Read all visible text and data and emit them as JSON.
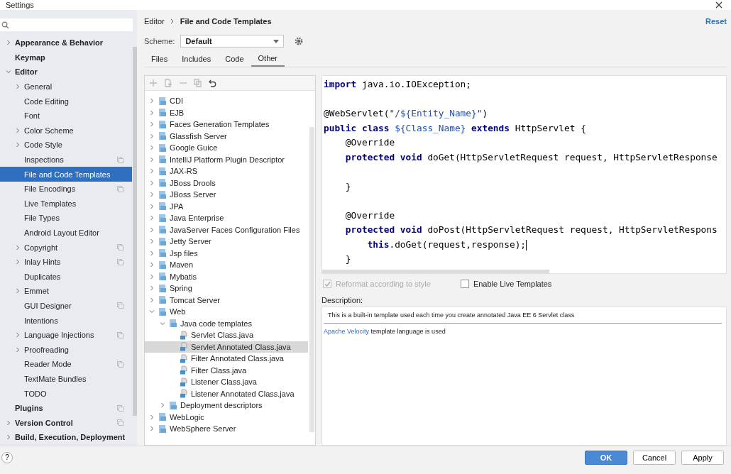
{
  "window": {
    "title": "Settings"
  },
  "sidebar": {
    "items": [
      {
        "label": "Appearance & Behavior",
        "kind": "group",
        "expanded": false,
        "selected": false,
        "scoped": false
      },
      {
        "label": "Keymap",
        "kind": "leaf",
        "selected": false,
        "scoped": false
      },
      {
        "label": "Editor",
        "kind": "group",
        "expanded": true,
        "selected": false,
        "scoped": false,
        "children": [
          {
            "label": "General",
            "kind": "group",
            "expanded": false,
            "selected": false,
            "scoped": false
          },
          {
            "label": "Code Editing",
            "kind": "leaf",
            "selected": false,
            "scoped": false
          },
          {
            "label": "Font",
            "kind": "leaf",
            "selected": false,
            "scoped": false
          },
          {
            "label": "Color Scheme",
            "kind": "group",
            "expanded": false,
            "selected": false,
            "scoped": false
          },
          {
            "label": "Code Style",
            "kind": "group",
            "expanded": false,
            "selected": false,
            "scoped": false
          },
          {
            "label": "Inspections",
            "kind": "leaf",
            "selected": false,
            "scoped": true
          },
          {
            "label": "File and Code Templates",
            "kind": "leaf",
            "selected": true,
            "scoped": false
          },
          {
            "label": "File Encodings",
            "kind": "leaf",
            "selected": false,
            "scoped": true
          },
          {
            "label": "Live Templates",
            "kind": "leaf",
            "selected": false,
            "scoped": false
          },
          {
            "label": "File Types",
            "kind": "leaf",
            "selected": false,
            "scoped": false
          },
          {
            "label": "Android Layout Editor",
            "kind": "leaf",
            "selected": false,
            "scoped": false
          },
          {
            "label": "Copyright",
            "kind": "group",
            "expanded": false,
            "selected": false,
            "scoped": true
          },
          {
            "label": "Inlay Hints",
            "kind": "group",
            "expanded": false,
            "selected": false,
            "scoped": true
          },
          {
            "label": "Duplicates",
            "kind": "leaf",
            "selected": false,
            "scoped": false
          },
          {
            "label": "Emmet",
            "kind": "group",
            "expanded": false,
            "selected": false,
            "scoped": false
          },
          {
            "label": "GUI Designer",
            "kind": "leaf",
            "selected": false,
            "scoped": true
          },
          {
            "label": "Intentions",
            "kind": "leaf",
            "selected": false,
            "scoped": false
          },
          {
            "label": "Language Injections",
            "kind": "group",
            "expanded": false,
            "selected": false,
            "scoped": true
          },
          {
            "label": "Proofreading",
            "kind": "group",
            "expanded": false,
            "selected": false,
            "scoped": false
          },
          {
            "label": "Reader Mode",
            "kind": "leaf",
            "selected": false,
            "scoped": true
          },
          {
            "label": "TextMate Bundles",
            "kind": "leaf",
            "selected": false,
            "scoped": false
          },
          {
            "label": "TODO",
            "kind": "leaf",
            "selected": false,
            "scoped": false
          }
        ]
      },
      {
        "label": "Plugins",
        "kind": "leaf",
        "selected": false,
        "scoped": true
      },
      {
        "label": "Version Control",
        "kind": "group",
        "expanded": false,
        "selected": false,
        "scoped": true
      },
      {
        "label": "Build, Execution, Deployment",
        "kind": "group",
        "expanded": false,
        "selected": false,
        "scoped": false
      }
    ]
  },
  "breadcrumb": [
    "Editor",
    "File and Code Templates"
  ],
  "reset": "Reset",
  "scheme": {
    "label": "Scheme:",
    "value": "Default"
  },
  "tabs": [
    {
      "label": "Files",
      "selected": false
    },
    {
      "label": "Includes",
      "selected": false
    },
    {
      "label": "Code",
      "selected": false
    },
    {
      "label": "Other",
      "selected": true
    }
  ],
  "toolbar": [
    {
      "kind": "add",
      "disabled": true
    },
    {
      "kind": "child",
      "disabled": true
    },
    {
      "kind": "remove",
      "disabled": true
    },
    {
      "kind": "copy",
      "disabled": true
    },
    {
      "kind": "reset",
      "disabled": false
    }
  ],
  "templates": [
    {
      "label": "CDI",
      "kind": "group",
      "expanded": false,
      "selected": false
    },
    {
      "label": "EJB",
      "kind": "group",
      "expanded": false,
      "selected": false
    },
    {
      "label": "Faces Generation Templates",
      "kind": "group",
      "expanded": false,
      "selected": false
    },
    {
      "label": "Glassfish Server",
      "kind": "group",
      "expanded": false,
      "selected": false
    },
    {
      "label": "Google Guice",
      "kind": "group",
      "expanded": false,
      "selected": false
    },
    {
      "label": "IntelliJ Platform Plugin Descriptor",
      "kind": "group",
      "expanded": false,
      "selected": false
    },
    {
      "label": "JAX-RS",
      "kind": "group",
      "expanded": false,
      "selected": false
    },
    {
      "label": "JBoss Drools",
      "kind": "group",
      "expanded": false,
      "selected": false
    },
    {
      "label": "JBoss Server",
      "kind": "group",
      "expanded": false,
      "selected": false
    },
    {
      "label": "JPA",
      "kind": "group",
      "expanded": false,
      "selected": false
    },
    {
      "label": "Java Enterprise",
      "kind": "group",
      "expanded": false,
      "selected": false
    },
    {
      "label": "JavaServer Faces Configuration Files",
      "kind": "group",
      "expanded": false,
      "selected": false
    },
    {
      "label": "Jetty Server",
      "kind": "group",
      "expanded": false,
      "selected": false
    },
    {
      "label": "Jsp files",
      "kind": "group",
      "expanded": false,
      "selected": false
    },
    {
      "label": "Maven",
      "kind": "group",
      "expanded": false,
      "selected": false
    },
    {
      "label": "Mybatis",
      "kind": "group",
      "expanded": false,
      "selected": false
    },
    {
      "label": "Spring",
      "kind": "group",
      "expanded": false,
      "selected": false
    },
    {
      "label": "Tomcat Server",
      "kind": "group",
      "expanded": false,
      "selected": false
    },
    {
      "label": "Web",
      "kind": "group",
      "expanded": true,
      "selected": false,
      "children": [
        {
          "label": "Java code templates",
          "kind": "group",
          "expanded": true,
          "selected": false,
          "children": [
            {
              "label": "Servlet Class.java",
              "kind": "leaf",
              "selected": false
            },
            {
              "label": "Servlet Annotated Class.java",
              "kind": "leaf",
              "selected": true
            },
            {
              "label": "Filter Annotated Class.java",
              "kind": "leaf",
              "selected": false
            },
            {
              "label": "Filter Class.java",
              "kind": "leaf",
              "selected": false
            },
            {
              "label": "Listener Class.java",
              "kind": "leaf",
              "selected": false
            },
            {
              "label": "Listener Annotated Class.java",
              "kind": "leaf",
              "selected": false
            }
          ]
        },
        {
          "label": "Deployment descriptors",
          "kind": "group",
          "expanded": false,
          "selected": false
        }
      ]
    },
    {
      "label": "WebLogic",
      "kind": "group",
      "expanded": false,
      "selected": false
    },
    {
      "label": "WebSphere Server",
      "kind": "group",
      "expanded": false,
      "selected": false
    }
  ],
  "code": [
    {
      "kind": "code",
      "tokens": [
        {
          "kind": "kw",
          "t": "import"
        },
        {
          "kind": "plain",
          "t": " java.io.IOException;"
        }
      ]
    },
    {
      "kind": "blank"
    },
    {
      "kind": "code",
      "tokens": [
        {
          "kind": "plain",
          "t": "@WebServlet("
        },
        {
          "kind": "str",
          "t": "\"/"
        },
        {
          "kind": "var",
          "t": "${Entity_Name}"
        },
        {
          "kind": "str",
          "t": "\""
        },
        {
          "kind": "plain",
          "t": ")"
        }
      ]
    },
    {
      "kind": "code",
      "tokens": [
        {
          "kind": "kw",
          "t": "public class "
        },
        {
          "kind": "var",
          "t": "${Class_Name}"
        },
        {
          "kind": "kw",
          "t": " extends"
        },
        {
          "kind": "plain",
          "t": " HttpServlet {"
        }
      ]
    },
    {
      "kind": "code",
      "tokens": [
        {
          "kind": "plain",
          "t": "    @Override"
        }
      ]
    },
    {
      "kind": "code",
      "tokens": [
        {
          "kind": "kw",
          "t": "    protected void"
        },
        {
          "kind": "plain",
          "t": " doGet(HttpServletRequest request, HttpServletResponse"
        }
      ]
    },
    {
      "kind": "blank"
    },
    {
      "kind": "code",
      "tokens": [
        {
          "kind": "plain",
          "t": "    }"
        }
      ]
    },
    {
      "kind": "blank"
    },
    {
      "kind": "code",
      "tokens": [
        {
          "kind": "plain",
          "t": "    @Override"
        }
      ]
    },
    {
      "kind": "code",
      "tokens": [
        {
          "kind": "kw",
          "t": "    protected void"
        },
        {
          "kind": "plain",
          "t": " doPost(HttpServletRequest request, HttpServletRespons"
        }
      ]
    },
    {
      "kind": "code",
      "caret": true,
      "tokens": [
        {
          "kind": "kw",
          "t": "        this"
        },
        {
          "kind": "plain",
          "t": ".doGet(request,response);"
        }
      ]
    },
    {
      "kind": "code",
      "tokens": [
        {
          "kind": "plain",
          "t": "    }"
        }
      ]
    }
  ],
  "options": [
    {
      "label": "Reformat according to style",
      "checked": true,
      "disabled": true
    },
    {
      "label": "Enable Live Templates",
      "checked": false,
      "disabled": false
    }
  ],
  "description": {
    "label": "Description:",
    "text": "This is a built-in template used each time you create annotated Java EE 6 Servlet class",
    "link": "Apache Velocity",
    "link_suffix": "template language is used"
  },
  "buttons": [
    {
      "label": "OK",
      "primary": true
    },
    {
      "label": "Cancel",
      "primary": false
    },
    {
      "label": "Apply",
      "primary": false
    }
  ],
  "help": "?"
}
